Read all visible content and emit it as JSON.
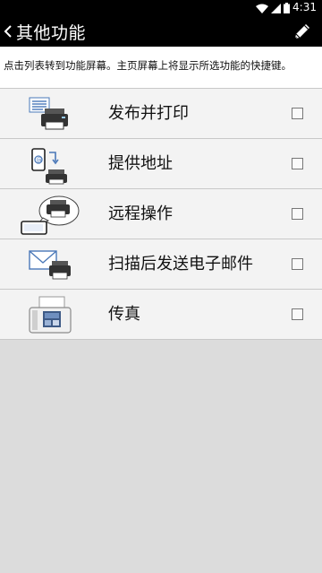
{
  "status_bar": {
    "time": "4:31",
    "icons": [
      "wifi-icon",
      "signal-icon",
      "battery-icon"
    ]
  },
  "app_bar": {
    "title": "其他功能",
    "back_icon": "chevron-left-icon",
    "action_icon": "pencil-icon"
  },
  "description": "点击列表转到功能屏幕。主页屏幕上将显示所选功能的快捷键。",
  "items": [
    {
      "label": "发布并打印",
      "icon": "print-release-icon",
      "checked": false
    },
    {
      "label": "提供地址",
      "icon": "provide-address-icon",
      "checked": false
    },
    {
      "label": "远程操作",
      "icon": "remote-operation-icon",
      "checked": false
    },
    {
      "label": "扫描后发送电子邮件",
      "icon": "scan-to-email-icon",
      "checked": false
    },
    {
      "label": "传真",
      "icon": "fax-icon",
      "checked": false
    }
  ],
  "colors": {
    "bar": "#000000",
    "list_background": "#f3f3f3",
    "empty_background": "#dcdcdc",
    "divider": "#c8c8c8"
  }
}
